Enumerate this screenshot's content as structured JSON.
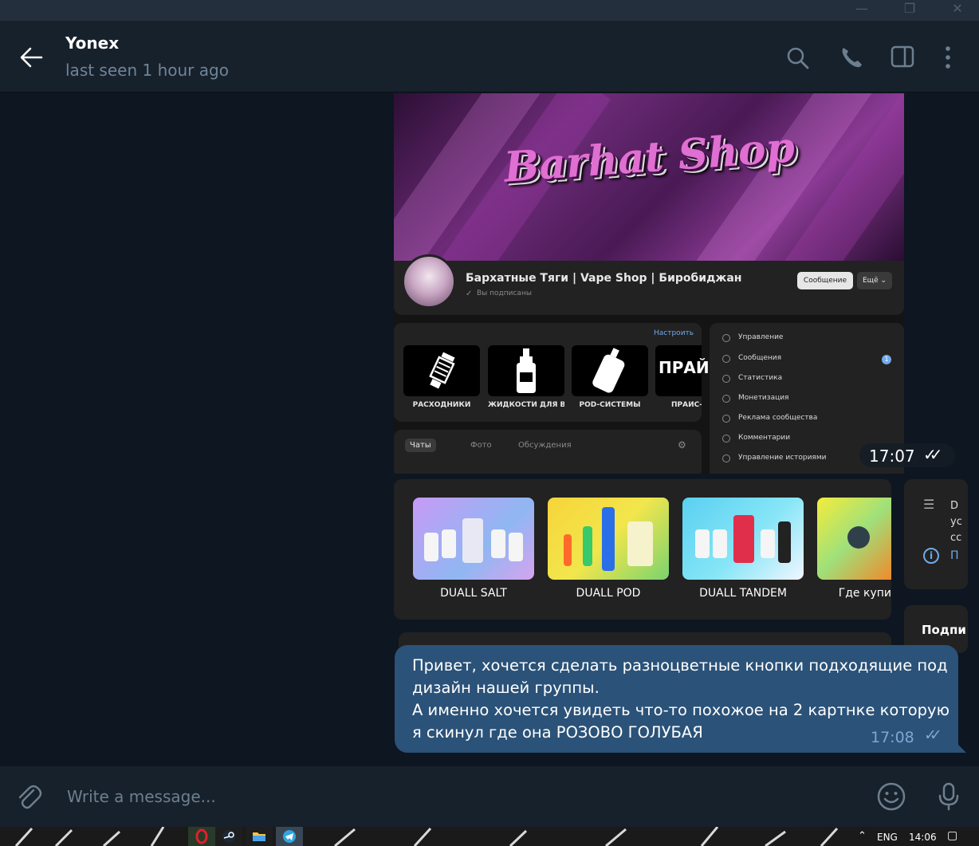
{
  "window": {
    "controls": {
      "minimize_icon": "minimize-icon",
      "restore_icon": "restore-icon",
      "close_icon": "close-icon"
    }
  },
  "header": {
    "title": "Yonex",
    "status": "last seen 1 hour ago",
    "icons": [
      "back-arrow-icon",
      "search-icon",
      "phone-icon",
      "sidebar-toggle-icon",
      "more-vertical-icon"
    ]
  },
  "messages": {
    "screenshot1": {
      "banner_logo": "Barhat Shop",
      "group_name": "Бархатные Тяги | Vape Shop | Биробиджан",
      "subscribed": "Вы подписаны",
      "message_button": "Сообщение",
      "more_button": "Ещё ⌄",
      "setup_link": "Настроить",
      "products": [
        {
          "label": "РАСХОДНИКИ",
          "icon": "atomizer-icon"
        },
        {
          "label": "ЖИДКОСТИ ДЛЯ В...",
          "icon": "liquid-bottle-icon"
        },
        {
          "label": "POD-СИСТЕМЫ",
          "icon": "pod-device-icon"
        },
        {
          "label": "ПРАЙС-Л",
          "icon": "price-list-icon"
        }
      ],
      "product_art_text": "ПРАЙС-Л",
      "tabs": [
        "Чаты",
        "Фото",
        "Обсуждения"
      ],
      "menu": [
        "Управление",
        "Сообщения",
        "Статистика",
        "Монетизация",
        "Реклама сообщества",
        "Комментарии",
        "Управление историями"
      ],
      "menu_badge": "1",
      "time": "17:07",
      "checkmarks": "✓✓"
    },
    "screenshot2": {
      "cards": [
        {
          "label": "DUALL SALT"
        },
        {
          "label": "DUALL POD"
        },
        {
          "label": "DUALL TANDEM"
        },
        {
          "label": "Где купи"
        }
      ],
      "side_text": [
        "D",
        "ус",
        "сс",
        "П"
      ],
      "side_label2": "Подпи"
    },
    "text_message": {
      "lines": [
        "Привет, хочется сделать разноцветные кнопки подходящие под",
        "дизайн нашей группы.",
        "А именно хочется увидеть что-то похожое на 2 картнке которую",
        "я скинул где она РОЗОВО ГОЛУБАЯ"
      ],
      "time": "17:08",
      "checkmarks": "✓✓"
    }
  },
  "composer": {
    "placeholder": "Write a message...",
    "icons": [
      "paperclip-icon",
      "emoji-icon",
      "microphone-icon"
    ]
  },
  "taskbar": {
    "apps": [
      "opera-icon",
      "steam-icon",
      "file-explorer-icon",
      "telegram-icon"
    ],
    "language": "ENG",
    "clock": "14:06",
    "tray_icons": [
      "chevron-up-icon",
      "notification-icon"
    ]
  }
}
